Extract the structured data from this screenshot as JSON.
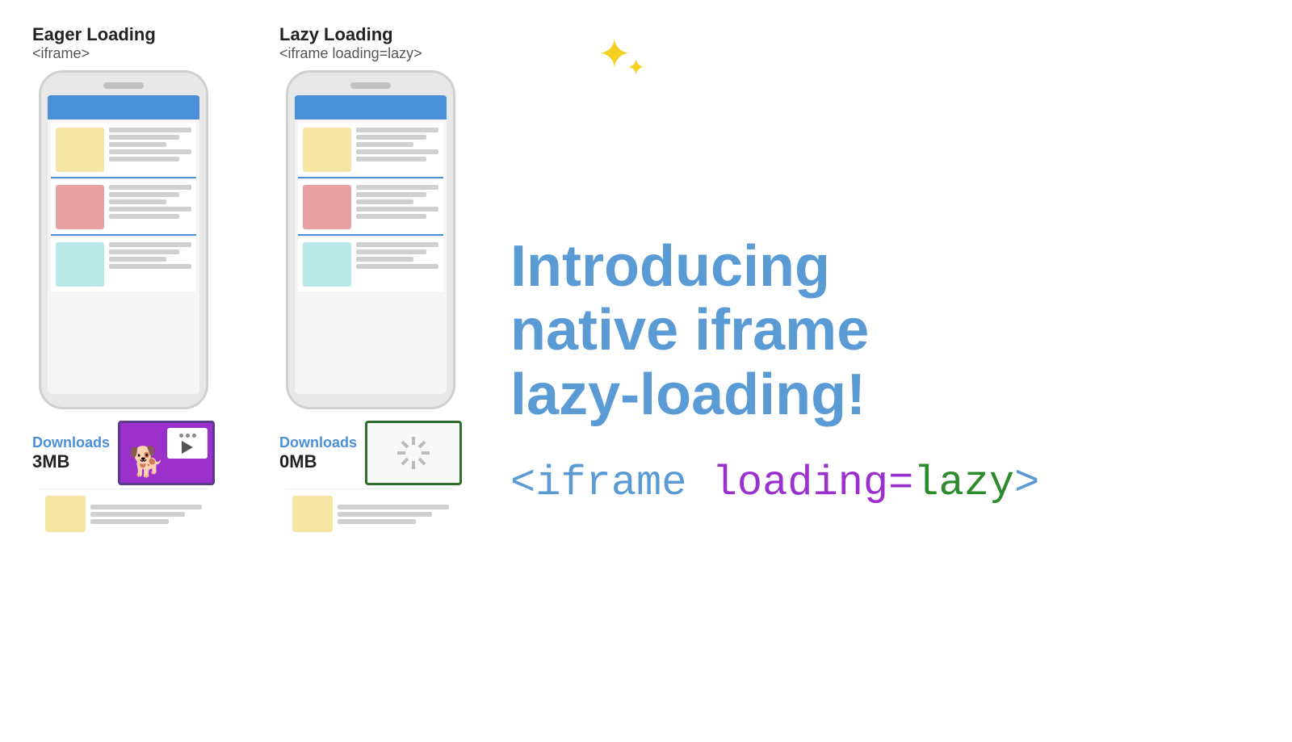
{
  "eager": {
    "title": "Eager Loading",
    "subtitle": "<iframe>",
    "downloads_label": "Downloads",
    "downloads_size": "3MB"
  },
  "lazy": {
    "title": "Lazy Loading",
    "subtitle": "<iframe loading=lazy>",
    "downloads_label": "Downloads",
    "downloads_size": "0MB"
  },
  "intro": {
    "heading_line1": "Introducing",
    "heading_line2": "native iframe",
    "heading_line3": "lazy-loading!"
  },
  "code": {
    "part1": "<iframe ",
    "part2": "loading=",
    "part3": "lazy",
    "part4": ">"
  }
}
